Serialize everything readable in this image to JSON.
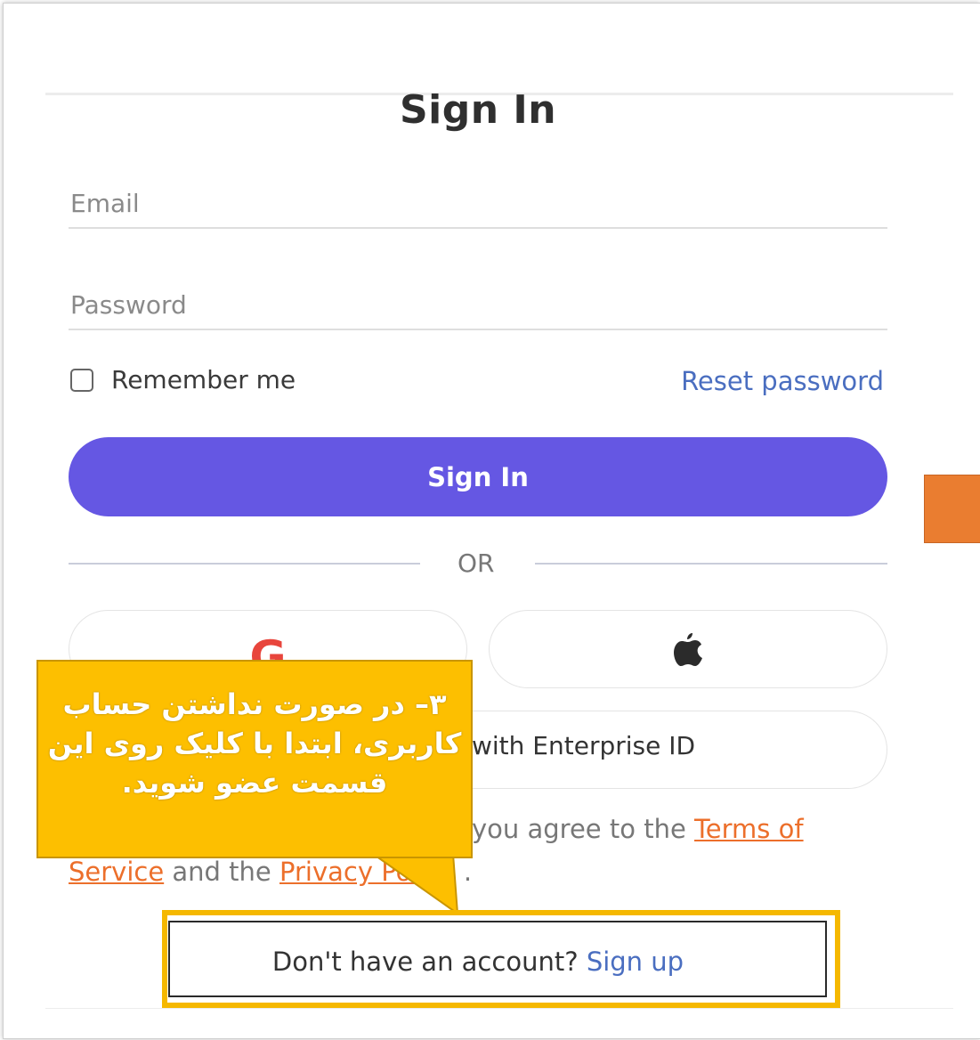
{
  "form": {
    "title": "Sign In",
    "email_placeholder": "Email",
    "password_placeholder": "Password",
    "remember_label": "Remember me",
    "reset_link": "Reset password",
    "signin_button": "Sign In",
    "divider_text": "OR",
    "google_icon": "google-icon",
    "apple_icon": "apple-icon",
    "enterprise_text": "with Enterprise ID",
    "terms": {
      "fragment_1": "you agree to the",
      "terms_link": "Terms of Service",
      "fragment_2": "and the",
      "privacy_link": "Privacy Policy",
      "end": "."
    },
    "signup_prompt": "Don't have an account?",
    "signup_link": "Sign up"
  },
  "annotation": {
    "callout_text": "۳– در صورت نداشتن حساب کاربری، ابتدا با کلیک روی این قسمت عضو شوید."
  },
  "colors": {
    "accent": "#6557e3",
    "link": "#4a6ec0",
    "terms_link": "#ec6f2b",
    "callout": "#fdbf00",
    "orange_marker": "#ea7d30"
  }
}
